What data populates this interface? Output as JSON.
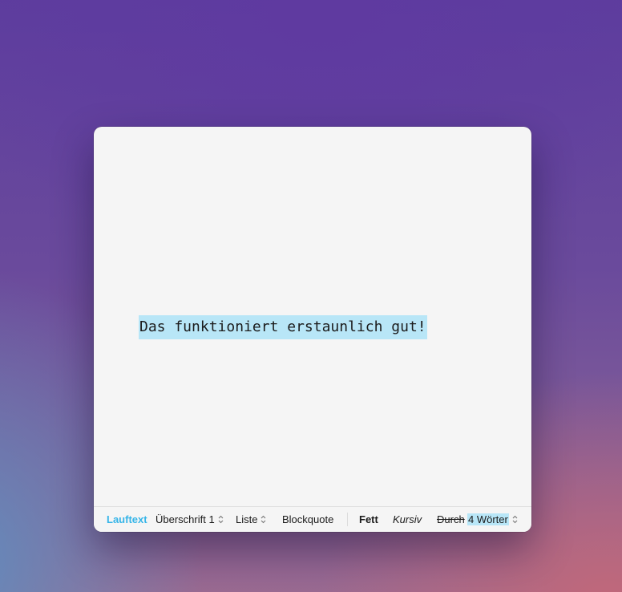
{
  "editor": {
    "text": "Das funktioniert erstaunlich gut!"
  },
  "toolbar": {
    "paragraph_style": "Lauftext",
    "heading": "Überschrift 1",
    "list": "Liste",
    "blockquote": "Blockquote",
    "bold": "Fett",
    "italic": "Kursiv",
    "strikethrough": "Durch",
    "word_count": "4 Wörter"
  },
  "colors": {
    "accent": "#36b5e8",
    "selection": "#b8e6f7"
  }
}
